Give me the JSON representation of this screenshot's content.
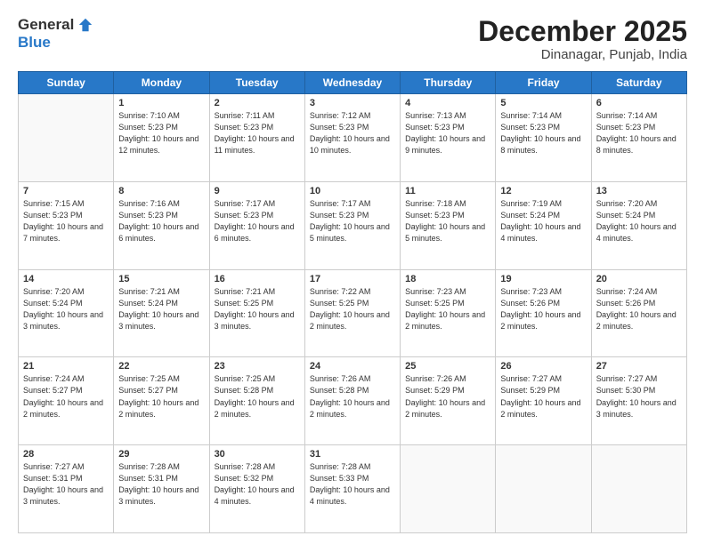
{
  "header": {
    "logo_general": "General",
    "logo_blue": "Blue",
    "month_title": "December 2025",
    "location": "Dinanagar, Punjab, India"
  },
  "days_of_week": [
    "Sunday",
    "Monday",
    "Tuesday",
    "Wednesday",
    "Thursday",
    "Friday",
    "Saturday"
  ],
  "weeks": [
    [
      {
        "day": "",
        "sunrise": "",
        "sunset": "",
        "daylight": ""
      },
      {
        "day": "1",
        "sunrise": "Sunrise: 7:10 AM",
        "sunset": "Sunset: 5:23 PM",
        "daylight": "Daylight: 10 hours and 12 minutes."
      },
      {
        "day": "2",
        "sunrise": "Sunrise: 7:11 AM",
        "sunset": "Sunset: 5:23 PM",
        "daylight": "Daylight: 10 hours and 11 minutes."
      },
      {
        "day": "3",
        "sunrise": "Sunrise: 7:12 AM",
        "sunset": "Sunset: 5:23 PM",
        "daylight": "Daylight: 10 hours and 10 minutes."
      },
      {
        "day": "4",
        "sunrise": "Sunrise: 7:13 AM",
        "sunset": "Sunset: 5:23 PM",
        "daylight": "Daylight: 10 hours and 9 minutes."
      },
      {
        "day": "5",
        "sunrise": "Sunrise: 7:14 AM",
        "sunset": "Sunset: 5:23 PM",
        "daylight": "Daylight: 10 hours and 8 minutes."
      },
      {
        "day": "6",
        "sunrise": "Sunrise: 7:14 AM",
        "sunset": "Sunset: 5:23 PM",
        "daylight": "Daylight: 10 hours and 8 minutes."
      }
    ],
    [
      {
        "day": "7",
        "sunrise": "Sunrise: 7:15 AM",
        "sunset": "Sunset: 5:23 PM",
        "daylight": "Daylight: 10 hours and 7 minutes."
      },
      {
        "day": "8",
        "sunrise": "Sunrise: 7:16 AM",
        "sunset": "Sunset: 5:23 PM",
        "daylight": "Daylight: 10 hours and 6 minutes."
      },
      {
        "day": "9",
        "sunrise": "Sunrise: 7:17 AM",
        "sunset": "Sunset: 5:23 PM",
        "daylight": "Daylight: 10 hours and 6 minutes."
      },
      {
        "day": "10",
        "sunrise": "Sunrise: 7:17 AM",
        "sunset": "Sunset: 5:23 PM",
        "daylight": "Daylight: 10 hours and 5 minutes."
      },
      {
        "day": "11",
        "sunrise": "Sunrise: 7:18 AM",
        "sunset": "Sunset: 5:23 PM",
        "daylight": "Daylight: 10 hours and 5 minutes."
      },
      {
        "day": "12",
        "sunrise": "Sunrise: 7:19 AM",
        "sunset": "Sunset: 5:24 PM",
        "daylight": "Daylight: 10 hours and 4 minutes."
      },
      {
        "day": "13",
        "sunrise": "Sunrise: 7:20 AM",
        "sunset": "Sunset: 5:24 PM",
        "daylight": "Daylight: 10 hours and 4 minutes."
      }
    ],
    [
      {
        "day": "14",
        "sunrise": "Sunrise: 7:20 AM",
        "sunset": "Sunset: 5:24 PM",
        "daylight": "Daylight: 10 hours and 3 minutes."
      },
      {
        "day": "15",
        "sunrise": "Sunrise: 7:21 AM",
        "sunset": "Sunset: 5:24 PM",
        "daylight": "Daylight: 10 hours and 3 minutes."
      },
      {
        "day": "16",
        "sunrise": "Sunrise: 7:21 AM",
        "sunset": "Sunset: 5:25 PM",
        "daylight": "Daylight: 10 hours and 3 minutes."
      },
      {
        "day": "17",
        "sunrise": "Sunrise: 7:22 AM",
        "sunset": "Sunset: 5:25 PM",
        "daylight": "Daylight: 10 hours and 2 minutes."
      },
      {
        "day": "18",
        "sunrise": "Sunrise: 7:23 AM",
        "sunset": "Sunset: 5:25 PM",
        "daylight": "Daylight: 10 hours and 2 minutes."
      },
      {
        "day": "19",
        "sunrise": "Sunrise: 7:23 AM",
        "sunset": "Sunset: 5:26 PM",
        "daylight": "Daylight: 10 hours and 2 minutes."
      },
      {
        "day": "20",
        "sunrise": "Sunrise: 7:24 AM",
        "sunset": "Sunset: 5:26 PM",
        "daylight": "Daylight: 10 hours and 2 minutes."
      }
    ],
    [
      {
        "day": "21",
        "sunrise": "Sunrise: 7:24 AM",
        "sunset": "Sunset: 5:27 PM",
        "daylight": "Daylight: 10 hours and 2 minutes."
      },
      {
        "day": "22",
        "sunrise": "Sunrise: 7:25 AM",
        "sunset": "Sunset: 5:27 PM",
        "daylight": "Daylight: 10 hours and 2 minutes."
      },
      {
        "day": "23",
        "sunrise": "Sunrise: 7:25 AM",
        "sunset": "Sunset: 5:28 PM",
        "daylight": "Daylight: 10 hours and 2 minutes."
      },
      {
        "day": "24",
        "sunrise": "Sunrise: 7:26 AM",
        "sunset": "Sunset: 5:28 PM",
        "daylight": "Daylight: 10 hours and 2 minutes."
      },
      {
        "day": "25",
        "sunrise": "Sunrise: 7:26 AM",
        "sunset": "Sunset: 5:29 PM",
        "daylight": "Daylight: 10 hours and 2 minutes."
      },
      {
        "day": "26",
        "sunrise": "Sunrise: 7:27 AM",
        "sunset": "Sunset: 5:29 PM",
        "daylight": "Daylight: 10 hours and 2 minutes."
      },
      {
        "day": "27",
        "sunrise": "Sunrise: 7:27 AM",
        "sunset": "Sunset: 5:30 PM",
        "daylight": "Daylight: 10 hours and 3 minutes."
      }
    ],
    [
      {
        "day": "28",
        "sunrise": "Sunrise: 7:27 AM",
        "sunset": "Sunset: 5:31 PM",
        "daylight": "Daylight: 10 hours and 3 minutes."
      },
      {
        "day": "29",
        "sunrise": "Sunrise: 7:28 AM",
        "sunset": "Sunset: 5:31 PM",
        "daylight": "Daylight: 10 hours and 3 minutes."
      },
      {
        "day": "30",
        "sunrise": "Sunrise: 7:28 AM",
        "sunset": "Sunset: 5:32 PM",
        "daylight": "Daylight: 10 hours and 4 minutes."
      },
      {
        "day": "31",
        "sunrise": "Sunrise: 7:28 AM",
        "sunset": "Sunset: 5:33 PM",
        "daylight": "Daylight: 10 hours and 4 minutes."
      },
      {
        "day": "",
        "sunrise": "",
        "sunset": "",
        "daylight": ""
      },
      {
        "day": "",
        "sunrise": "",
        "sunset": "",
        "daylight": ""
      },
      {
        "day": "",
        "sunrise": "",
        "sunset": "",
        "daylight": ""
      }
    ]
  ]
}
